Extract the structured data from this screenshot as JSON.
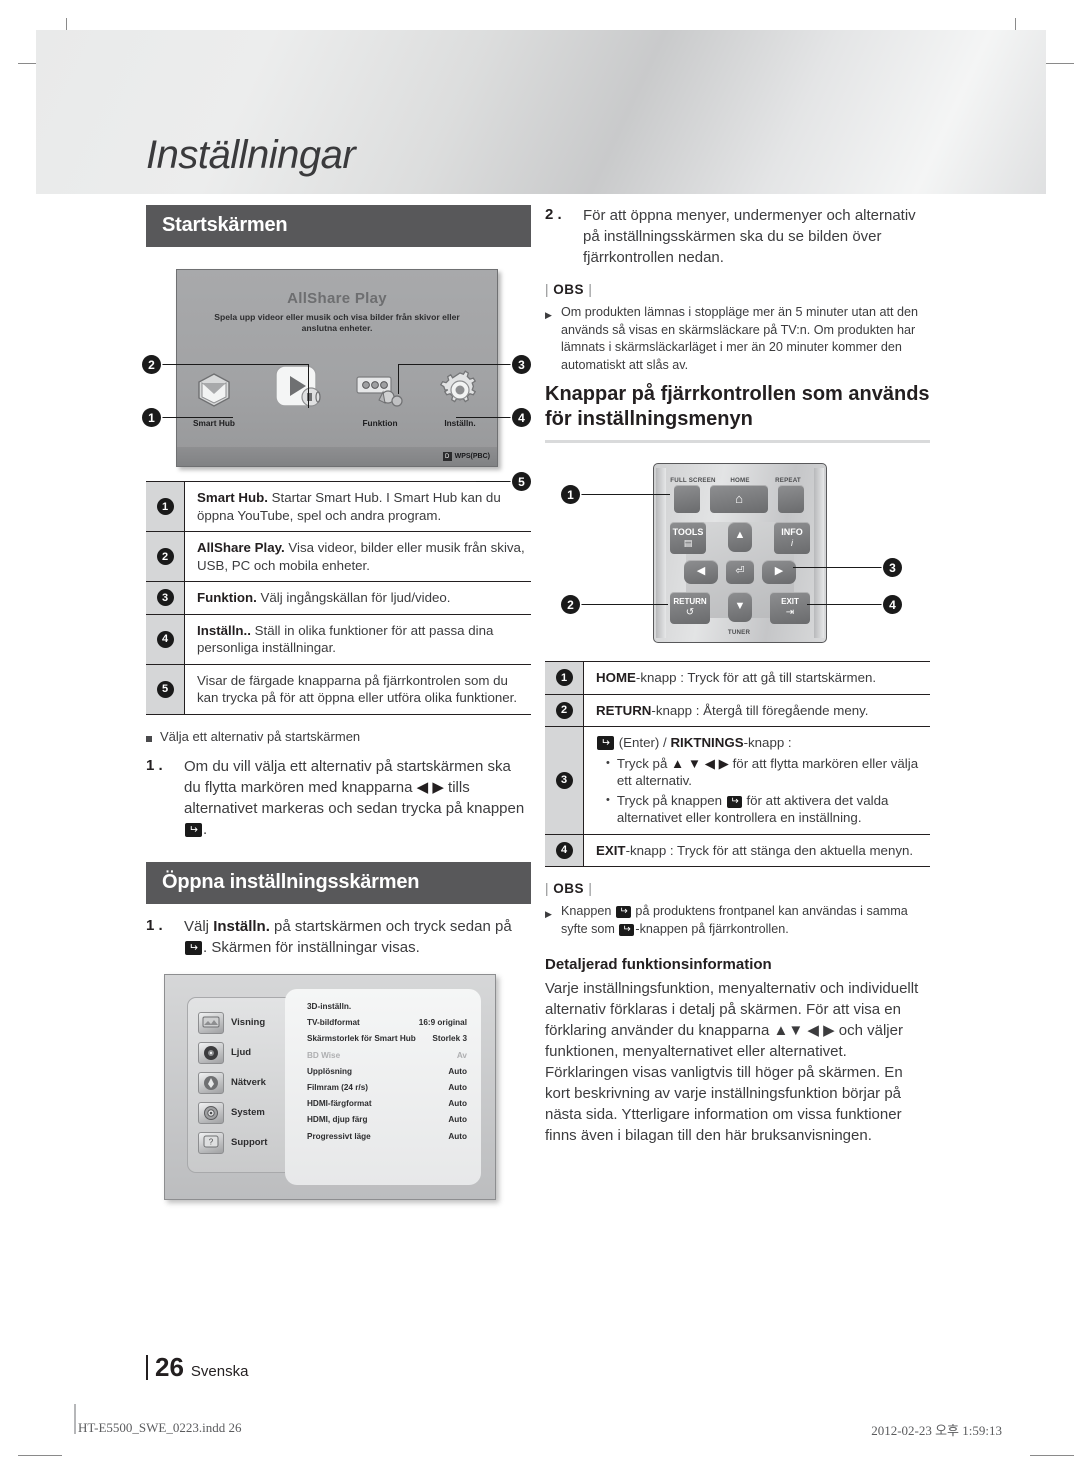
{
  "page": {
    "title": "Inställningar",
    "number": "26",
    "language": "Svenska",
    "footer_file": "HT-E5500_SWE_0223.indd   26",
    "footer_date": "2012-02-23   오후 1:59:13"
  },
  "left": {
    "section_heading": "Startskärmen",
    "home_screen": {
      "title": "AllShare Play",
      "subtitle": "Spela upp videor eller musik och visa bilder från skivor eller anslutna enheter.",
      "items": [
        {
          "label": "Smart Hub",
          "icon": "cube-icon"
        },
        {
          "label": "",
          "icon": "allshare-play-icon"
        },
        {
          "label": "Funktion",
          "icon": "function-icon"
        },
        {
          "label": "Inställn.",
          "icon": "gear-icon"
        }
      ],
      "footer_badge_key": "D",
      "footer_badge_text": "WPS(PBC)",
      "callouts": [
        "1",
        "2",
        "3",
        "4",
        "5"
      ]
    },
    "table": [
      {
        "num": "1",
        "bold": "Smart Hub.",
        "text": " Startar Smart Hub. I Smart Hub kan du öppna YouTube, spel och andra program."
      },
      {
        "num": "2",
        "bold": "AllShare Play.",
        "text": " Visa videor, bilder eller musik från skiva, USB, PC och mobila enheter."
      },
      {
        "num": "3",
        "bold": "Funktion.",
        "text": " Välj ingångskällan för ljud/video."
      },
      {
        "num": "4",
        "bold": "Inställn..",
        "text": " Ställ in olika funktioner för att passa dina personliga inställningar."
      },
      {
        "num": "5",
        "bold": "",
        "text": "Visar de färgade knapparna på fjärrkontrolen som du kan trycka på för att öppna eller utföra olika funktioner."
      }
    ],
    "bullet_sub": "Välja ett alternativ på startskärmen",
    "step1_no": "1 .",
    "step1_a": "Om du vill välja ett alternativ på startskärmen ska du flytta markören med knapparna ",
    "step1_arrows": "◀ ▶",
    "step1_b": " tills alternativet markeras och sedan trycka på knappen ",
    "step1_c": ".",
    "section_heading2": "Öppna inställningsskärmen",
    "step2_no": "1 .",
    "step2_a": "Välj ",
    "step2_bold": "Inställn.",
    "step2_b": " på startskärmen och tryck sedan på ",
    "step2_c": ". Skärmen för inställningar visas.",
    "settings_screen": {
      "nav": [
        {
          "label": "Visning",
          "icon": "display-icon"
        },
        {
          "label": "Ljud",
          "icon": "speaker-icon"
        },
        {
          "label": "Nätverk",
          "icon": "network-icon"
        },
        {
          "label": "System",
          "icon": "gear-icon"
        },
        {
          "label": "Support",
          "icon": "question-icon"
        }
      ],
      "rows": [
        {
          "name": "3D-inställn.",
          "value": "",
          "dim": false
        },
        {
          "name": "TV-bildformat",
          "value": "16:9 original",
          "dim": false
        },
        {
          "name": "Skärmstorlek för Smart Hub",
          "value": "Storlek 3",
          "dim": false
        },
        {
          "name": "BD Wise",
          "value": "Av",
          "dim": true
        },
        {
          "name": "Upplösning",
          "value": "Auto",
          "dim": false
        },
        {
          "name": "Filmram (24 r/s)",
          "value": "Auto",
          "dim": false
        },
        {
          "name": "HDMI-färgformat",
          "value": "Auto",
          "dim": false
        },
        {
          "name": "HDMI, djup färg",
          "value": "Auto",
          "dim": false
        },
        {
          "name": "Progressivt läge",
          "value": "Auto",
          "dim": false
        }
      ]
    }
  },
  "right": {
    "step2_no": "2 .",
    "step2_text": "För att öppna menyer, undermenyer och alternativ på inställningsskärmen ska du se bilden över fjärrkontrollen nedan.",
    "obs_label": "OBS",
    "note1": "Om produkten lämnas i stoppläge mer än 5 minuter utan att den används så visas en skärmsläckare på TV:n. Om produkten har lämnats i skärmsläckarläget i mer än 20 minuter kommer den automatiskt att slås av.",
    "heading": "Knappar på fjärrkontrollen som används för inställningsmenyn",
    "remote": {
      "labels": [
        "FULL SCREEN",
        "HOME",
        "REPEAT",
        "TOOLS",
        "INFO",
        "RETURN",
        "EXIT",
        "TUNER"
      ],
      "callouts": [
        "1",
        "2",
        "3",
        "4"
      ]
    },
    "table": [
      {
        "num": "1",
        "bold": "HOME",
        "text": "-knapp : Tryck för att gå till startskärmen."
      },
      {
        "num": "2",
        "bold": "RETURN",
        "text": "-knapp : Återgå till föregående meny."
      },
      {
        "num": "3",
        "bold": "",
        "text": ""
      },
      {
        "num": "4",
        "bold": "EXIT",
        "text": "-knapp : Tryck för att stänga den aktuella menyn."
      }
    ],
    "row3": {
      "head_a": "(Enter) / ",
      "head_bold": "RIKTNINGS",
      "head_b": "-knapp :",
      "b1_a": "Tryck på ",
      "b1_arrows": "▲ ▼ ◀ ▶",
      "b1_b": " för att flytta markören eller välja ett alternativ.",
      "b2_a": "Tryck på knappen ",
      "b2_b": " för att aktivera det valda alternativet eller kontrollera en inställning."
    },
    "obs2_label": "OBS",
    "note2_a": "Knappen ",
    "note2_b": " på produktens frontpanel kan användas i samma syfte som ",
    "note2_c": "-knappen på fjärrkontrollen.",
    "sub_heading": "Detaljerad funktionsinformation",
    "para_a": "Varje inställningsfunktion, menyalternativ och individuellt alternativ förklaras i detalj på skärmen. För att visa en förklaring använder du knapparna ",
    "para_arrows": "▲▼ ◀ ▶",
    "para_b": " och väljer funktionen, menyalternativet eller alternativet. Förklaringen visas vanligtvis till höger på skärmen. En kort beskrivning av varje inställningsfunktion börjar på nästa sida. Ytterligare information om vissa funktioner finns även i bilagan till den här bruksanvisningen."
  }
}
